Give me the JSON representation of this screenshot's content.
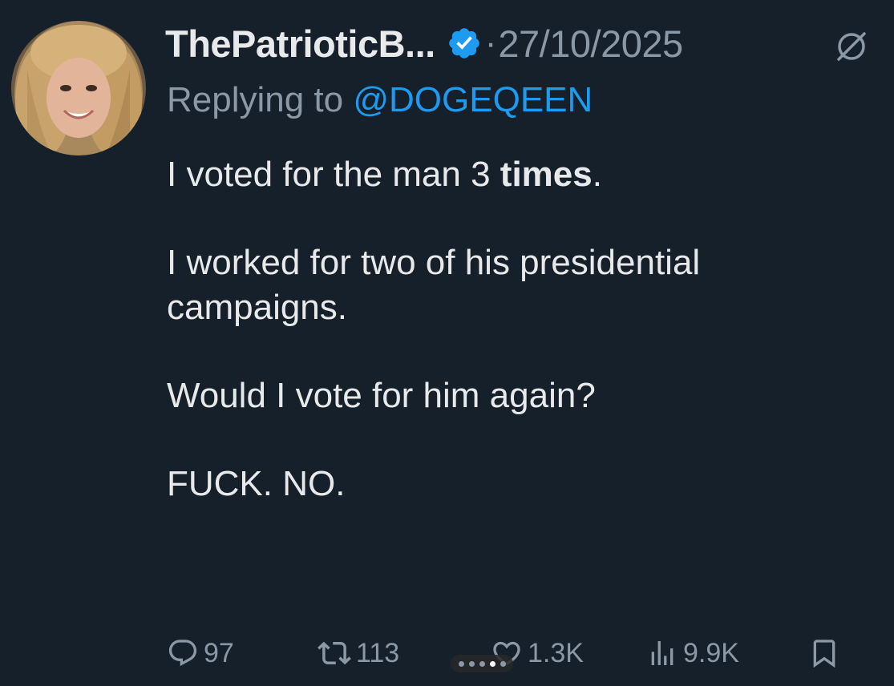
{
  "tweet": {
    "display_name": "ThePatrioticB...",
    "dot": "·",
    "date": "27/10/2025",
    "reply_prefix": "Replying to ",
    "reply_handle": "@DOGEQEEN",
    "para1_text": "I voted for the man 3 ",
    "para1_bold": "times",
    "para1_end": ".",
    "para2": "I worked for two of his presidential campaigns.",
    "para3": "Would I vote for him again?",
    "para4": "FUCK. NO."
  },
  "actions": {
    "replies": "97",
    "reposts": "113",
    "likes": "1.3K",
    "views": "9.9K"
  },
  "icons": {
    "verified": "verified-badge-icon",
    "grok": "grok-icon",
    "reply": "reply-icon",
    "repost": "repost-icon",
    "like": "heart-icon",
    "views": "bar-chart-icon",
    "bookmark": "bookmark-icon"
  },
  "colors": {
    "background": "#15202b",
    "accent": "#1d9bf0",
    "muted": "#8b98a5",
    "text": "#e7e9ea"
  },
  "pager": {
    "count": 5,
    "active": 3
  }
}
